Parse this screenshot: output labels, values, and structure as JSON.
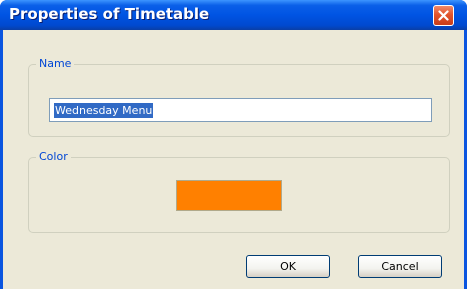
{
  "window": {
    "title": "Properties of Timetable"
  },
  "name_group": {
    "label": "Name",
    "value": "Wednesday Menu"
  },
  "color_group": {
    "label": "Color",
    "swatch_color": "#ff8000"
  },
  "buttons": {
    "ok_label": "OK",
    "cancel_label": "Cancel"
  },
  "icons": {
    "close": "close-icon"
  }
}
